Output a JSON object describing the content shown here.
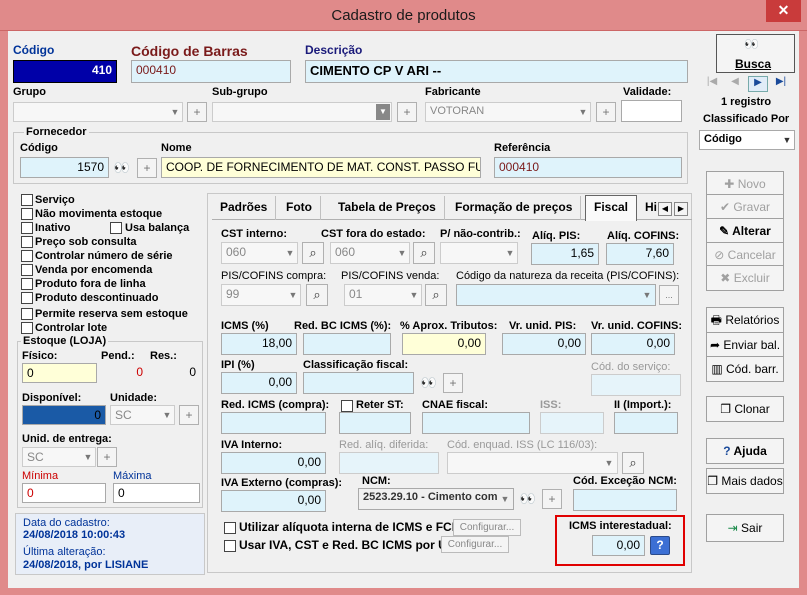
{
  "window": {
    "title": "Cadastro de produtos",
    "close": "✕"
  },
  "header": {
    "codigo_label": "Código",
    "codigo_value": "410",
    "barras_label": "Código de Barras",
    "barras_value": "000410",
    "descricao_label": "Descrição",
    "descricao_value": "CIMENTO CP V ARI --",
    "grupo_label": "Grupo",
    "subgrupo_label": "Sub-grupo",
    "fabricante_label": "Fabricante",
    "fabricante_value": "VOTORAN",
    "validade_label": "Validade:"
  },
  "fornecedor": {
    "title": "Fornecedor",
    "codigo_label": "Código",
    "codigo_value": "1570",
    "nome_label": "Nome",
    "nome_value": "COOP. DE FORNECIMENTO DE MAT. CONST. PASSO FUNDO",
    "referencia_label": "Referência",
    "referencia_value": "000410"
  },
  "flags": [
    {
      "label": "Serviço"
    },
    {
      "label": "Não movimenta estoque"
    },
    {
      "label": "Inativo"
    },
    {
      "label": "Usa balança"
    },
    {
      "label": "Preço sob consulta"
    },
    {
      "label": "Controlar número de série"
    },
    {
      "label": "Venda por encomenda"
    },
    {
      "label": "Produto fora de linha"
    },
    {
      "label": "Produto descontinuado"
    },
    {
      "label": "Permite reserva sem estoque"
    },
    {
      "label": "Controlar lote"
    }
  ],
  "estoque": {
    "title": "Estoque (LOJA)",
    "fisico_label": "Físico:",
    "fisico_value": "0",
    "pend_label": "Pend.:",
    "pend_value": "0",
    "res_label": "Res.:",
    "res_value": "0",
    "disponivel_label": "Disponível:",
    "disponivel_value": "0",
    "unidade_label": "Unidade:",
    "unidade_value": "SC",
    "unid_entrega_label": "Unid. de entrega:",
    "unid_entrega_value": "SC",
    "minima_label": "Mínima",
    "minima_value": "0",
    "maxima_label": "Máxima",
    "maxima_value": "0"
  },
  "footer_info": {
    "data_label": "Data do cadastro:",
    "data_value": "24/08/2018 10:00:43",
    "alteracao_label": "Última alteração:",
    "alteracao_value": "24/08/2018, por LISIANE"
  },
  "tabs": [
    {
      "label": "Padrões"
    },
    {
      "label": "Foto"
    },
    {
      "label": "Tabela de Preços"
    },
    {
      "label": "Formação de preços"
    },
    {
      "label": "Fiscal"
    },
    {
      "label": "Hi"
    }
  ],
  "fiscal": {
    "cst_interno_label": "CST interno:",
    "cst_interno_value": "060",
    "cst_fora_label": "CST fora do estado:",
    "cst_fora_value": "060",
    "nao_contrib_label": "P/ não-contrib.:",
    "aliq_pis_label": "Alíq. PIS:",
    "aliq_pis_value": "1,65",
    "aliq_cofins_label": "Alíq. COFINS:",
    "aliq_cofins_value": "7,60",
    "pis_compra_label": "PIS/COFINS compra:",
    "pis_compra_value": "99",
    "pis_venda_label": "PIS/COFINS venda:",
    "pis_venda_value": "01",
    "natureza_label": "Código da natureza da receita (PIS/COFINS):",
    "icms_label": "ICMS (%)",
    "icms_value": "18,00",
    "red_bc_label": "Red. BC ICMS (%):",
    "aprox_label": "% Aprox. Tributos:",
    "aprox_value": "0,00",
    "vr_pis_label": "Vr. unid. PIS:",
    "vr_pis_value": "0,00",
    "vr_cofins_label": "Vr. unid. COFINS:",
    "vr_cofins_value": "0,00",
    "ipi_label": "IPI (%)",
    "ipi_value": "0,00",
    "classif_label": "Classificação fiscal:",
    "cod_servico_label": "Cód. do serviço:",
    "red_icms_compra_label": "Red. ICMS (compra):",
    "reter_st_label": "Reter ST:",
    "cnae_label": "CNAE fiscal:",
    "iss_label": "ISS:",
    "ii_label": "II (Import.):",
    "iva_interno_label": "IVA Interno:",
    "iva_interno_value": "0,00",
    "red_aliq_label": "Red. alíq. diferida:",
    "cod_enquad_label": "Cód. enquad. ISS (LC 116/03):",
    "iva_externo_label": "IVA Externo (compras):",
    "iva_externo_value": "0,00",
    "ncm_label": "NCM:",
    "ncm_value": "2523.29.10 - Cimento com",
    "cod_excecao_label": "Cód. Exceção NCM:",
    "utilizar_label": "Utilizar alíquota interna de ICMS e FCP:",
    "usar_iva_label": "Usar IVA, CST e Red. BC ICMS por UF",
    "configurar_label": "Configurar...",
    "icms_inter_label": "ICMS interestadual:",
    "icms_inter_value": "0,00"
  },
  "sidebar": {
    "busca_label": "Busca",
    "registro_text": "1 registro",
    "classificado_label": "Classificado Por",
    "classificado_value": "Código",
    "novo": "Novo",
    "gravar": "Gravar",
    "alterar": "Alterar",
    "cancelar": "Cancelar",
    "excluir": "Excluir",
    "relatorios": "Relatórios",
    "enviar_bal": "Enviar bal.",
    "cod_barr": "Cód. barr.",
    "clonar": "Clonar",
    "ajuda": "Ajuda",
    "mais_dados": "Mais dados",
    "sair": "Sair"
  },
  "colors": {
    "highlight_box": "#e00000",
    "codigo_bg": "#0000a8"
  }
}
